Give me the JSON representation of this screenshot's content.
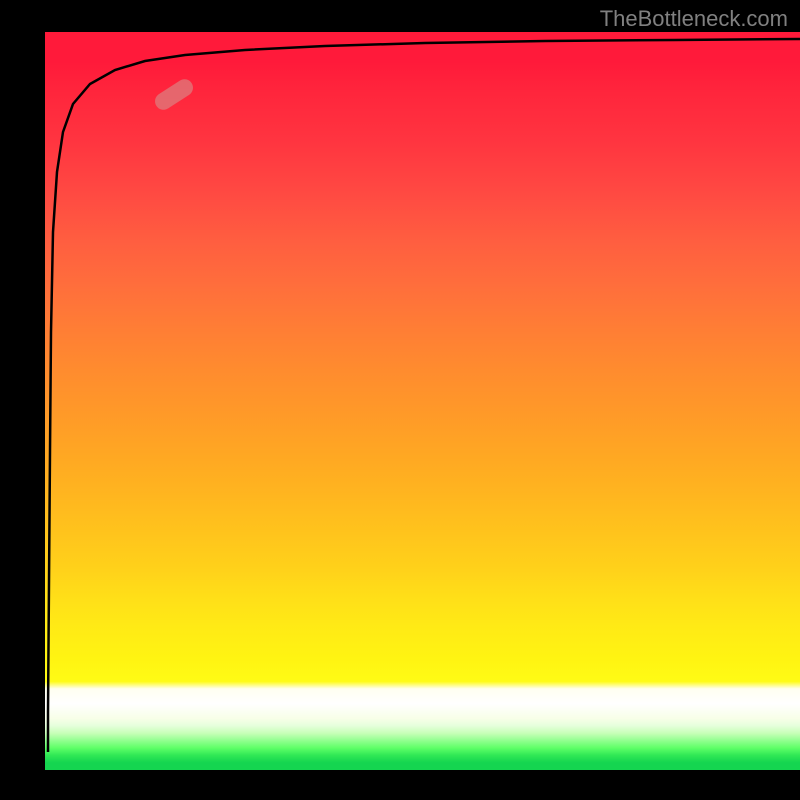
{
  "watermark": "TheBottleneck.com",
  "chart_data": {
    "type": "line",
    "title": "",
    "xlabel": "",
    "ylabel": "",
    "xlim": [
      0,
      100
    ],
    "ylim": [
      0,
      100
    ],
    "gradient_colors": {
      "top": "#ff1a3a",
      "middle_upper": "#ff8c2e",
      "middle": "#ffdd18",
      "middle_lower": "#ffffff",
      "bottom": "#15d550"
    },
    "series": [
      {
        "name": "curve",
        "x": [
          0.3,
          0.4,
          0.5,
          0.8,
          1.2,
          2,
          3,
          5,
          8,
          12,
          18,
          25,
          35,
          50,
          70,
          100
        ],
        "y": [
          3,
          20,
          40,
          60,
          75,
          85,
          90,
          93,
          95,
          96.2,
          96.8,
          97.2,
          97.5,
          97.8,
          98,
          98.2
        ]
      }
    ],
    "marker": {
      "x": 15,
      "y": 93,
      "color": "rgba(220,130,130,0.7)"
    }
  }
}
